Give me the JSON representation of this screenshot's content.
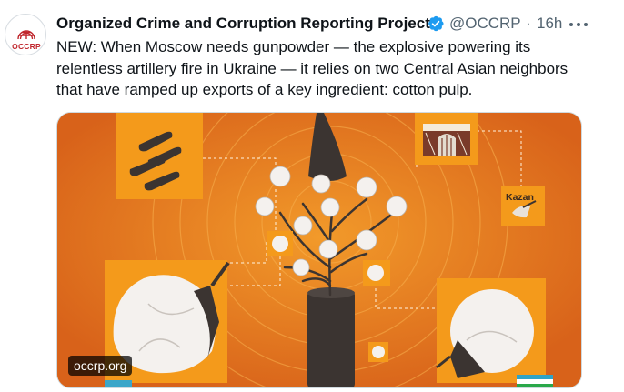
{
  "tweet": {
    "avatar_text": "OCCRP",
    "display_name": "Organized Crime and Corruption Reporting Project",
    "handle": "@OCCRP",
    "separator": "·",
    "time": "16h",
    "text": "NEW: When Moscow needs gunpowder — the explosive powering its relentless artillery fire in Ukraine — it relies on two Central Asian neighbors that have ramped up exports of a key ingredient: cotton pulp.",
    "icons": {
      "verified": "verified-badge-icon",
      "more": "more-options-icon"
    },
    "colors": {
      "verified": "#1d9bf0",
      "brand_red": "#c0262d",
      "secondary_text": "#536471"
    }
  },
  "media": {
    "kazan_label": "Kazan",
    "watermark": "occrp.org",
    "colors": {
      "background": "#e06f18",
      "panel": "#f49a1b",
      "dark": "#3b3431"
    }
  }
}
